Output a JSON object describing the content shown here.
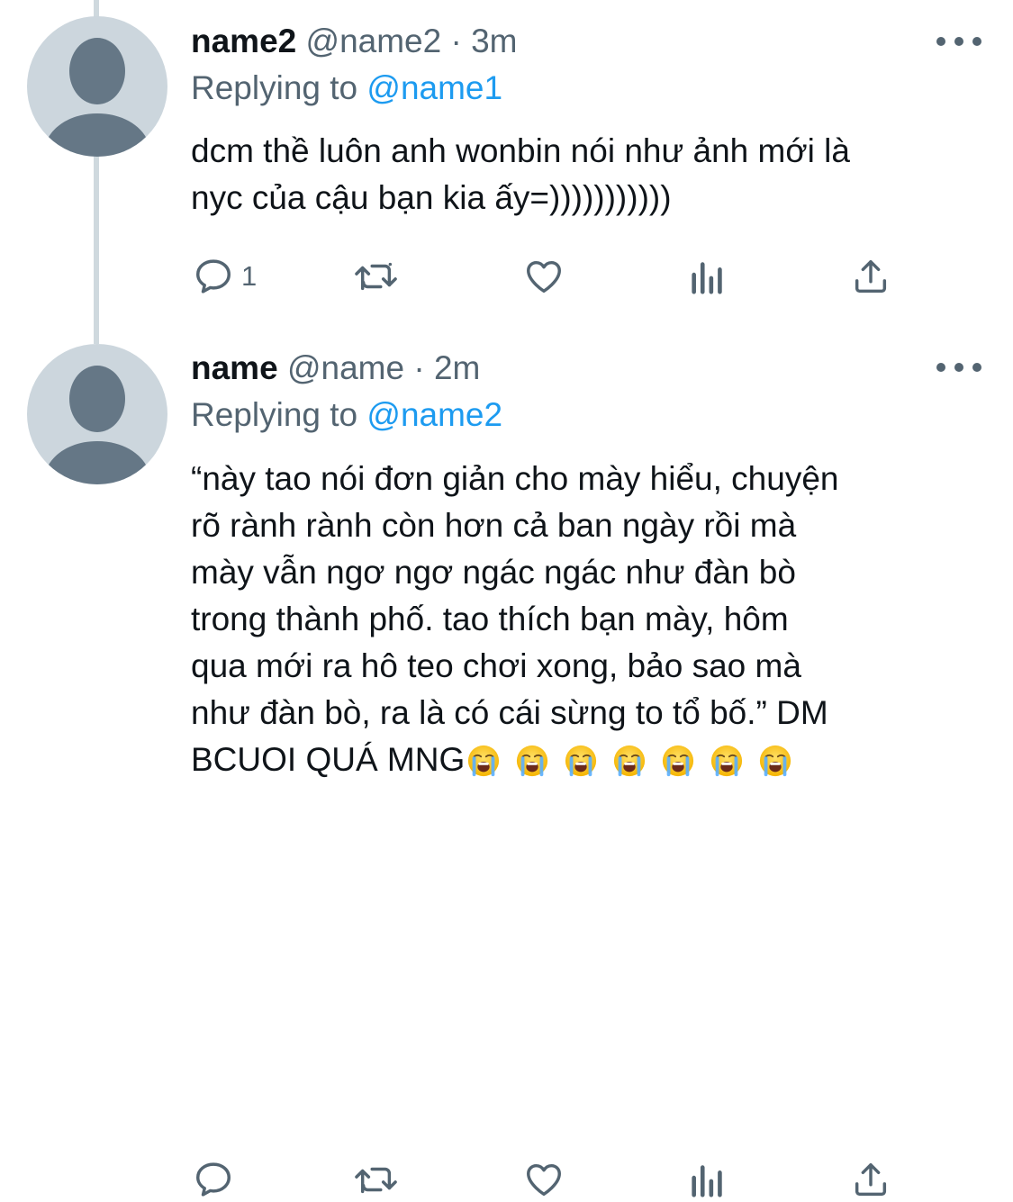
{
  "tweets": [
    {
      "display_name": "name2",
      "handle": "@name2",
      "time": "3m",
      "replying_label": "Replying to",
      "replying_to": "@name1",
      "body_lines": [
        "dcm thề luôn anh wonbin nói như ảnh mới là",
        "nyc của cậu bạn kia ấy=)))))))))))"
      ],
      "reply_count": "1"
    },
    {
      "display_name": "name",
      "handle": "@name",
      "time": "2m",
      "replying_label": "Replying to",
      "replying_to": "@name2",
      "body_lines": [
        "“này tao nói đơn giản cho mày hiểu, chuyện",
        "rõ rành rành còn hơn cả ban ngày rồi mà",
        "mày vẫn ngơ ngơ ngác ngác như đàn bò",
        "trong thành phố. tao thích bạn mày, hôm",
        "qua mới ra hô teo chơi xong, bảo sao mà",
        "như đàn bò, ra là có cái sừng to tổ bố.” DM",
        "BCUOI QUÁ MNG"
      ],
      "emoji": "loudly-crying-face",
      "emoji_count": 7
    }
  ],
  "icons": {
    "reply": "reply-icon",
    "retweet": "retweet-icon",
    "like": "heart-icon",
    "analytics": "analytics-icon",
    "share": "share-icon",
    "more": "more-icon"
  },
  "colors": {
    "link": "#1d9bf0",
    "secondary_text": "#536471",
    "avatar_bg": "#ccd6dd",
    "avatar_fg": "#657786",
    "thread_line": "#cfd9de"
  }
}
